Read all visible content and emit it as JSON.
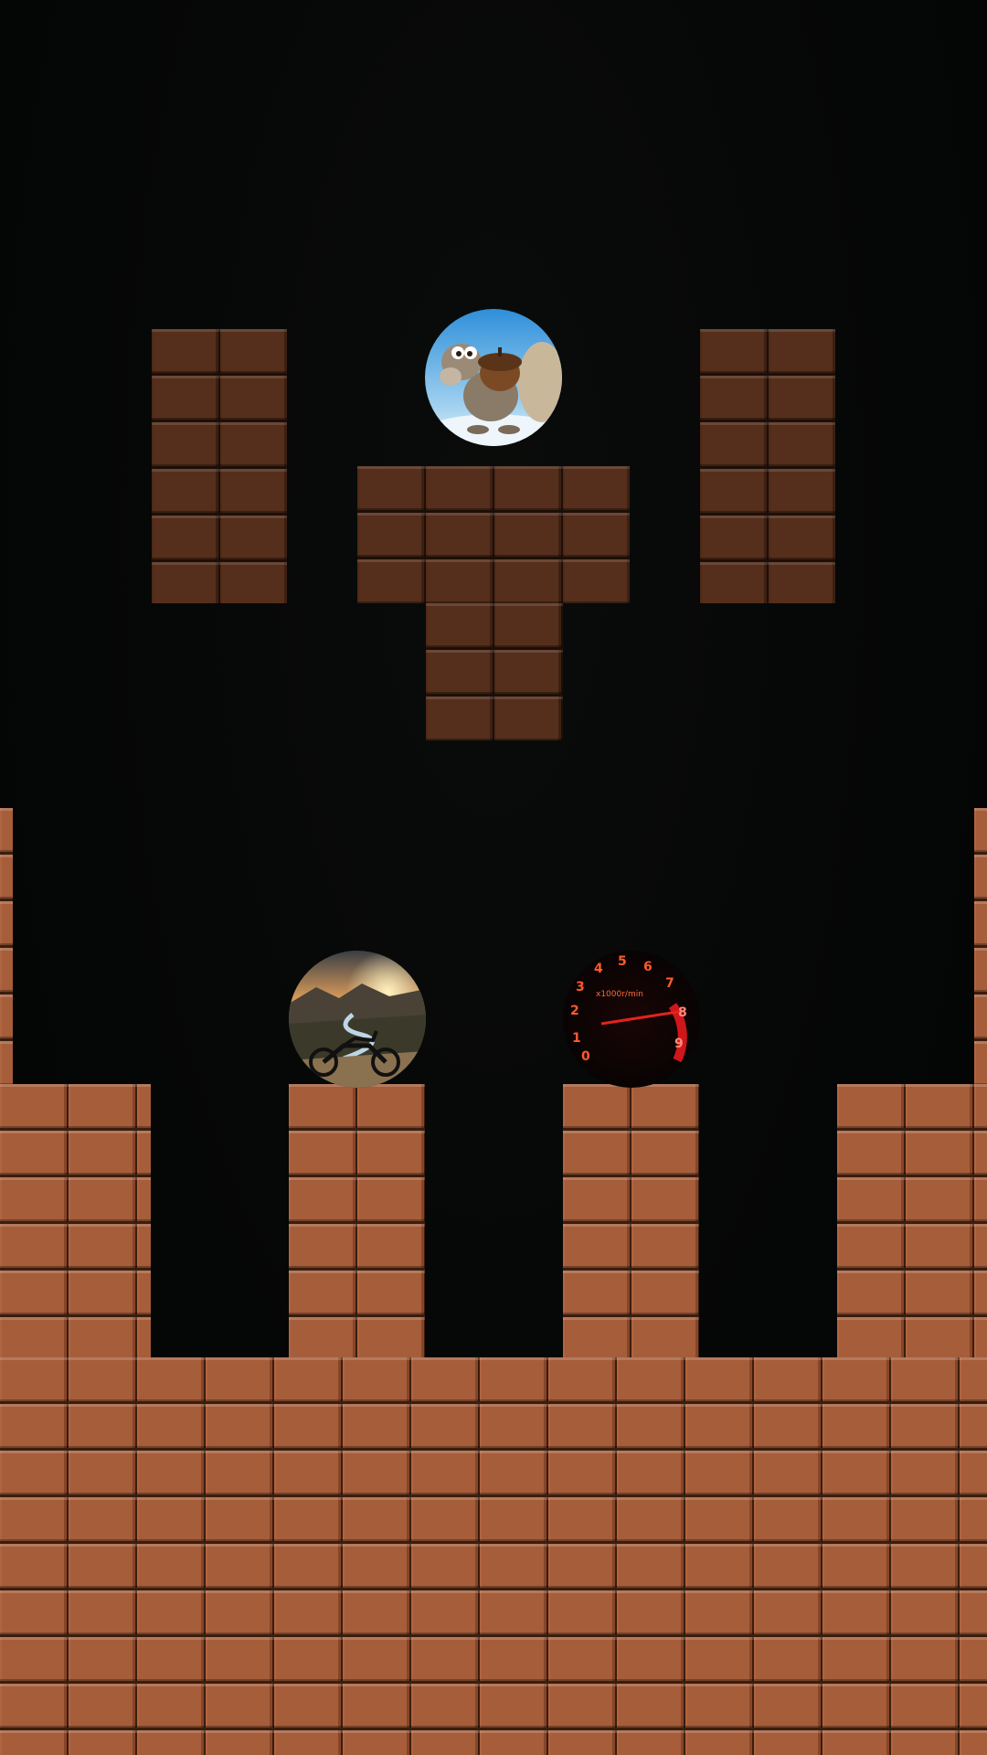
{
  "scene": {
    "background_color": "#050606",
    "brick_color_dark": "#552f1c",
    "brick_color_light": "#a55d3a"
  },
  "icons": [
    {
      "name": "squirrel-acorn-icon",
      "depicts": "cartoon squirrel holding acorn"
    },
    {
      "name": "motorcycle-landscape-icon",
      "depicts": "dirt bike at river valley sunset"
    },
    {
      "name": "tachometer-icon",
      "depicts": "red glowing rpm gauge"
    }
  ],
  "tachometer": {
    "numbers": [
      "0",
      "1",
      "2",
      "3",
      "4",
      "5",
      "6",
      "7",
      "8",
      "9"
    ],
    "unit_label": "x1000r/min"
  }
}
